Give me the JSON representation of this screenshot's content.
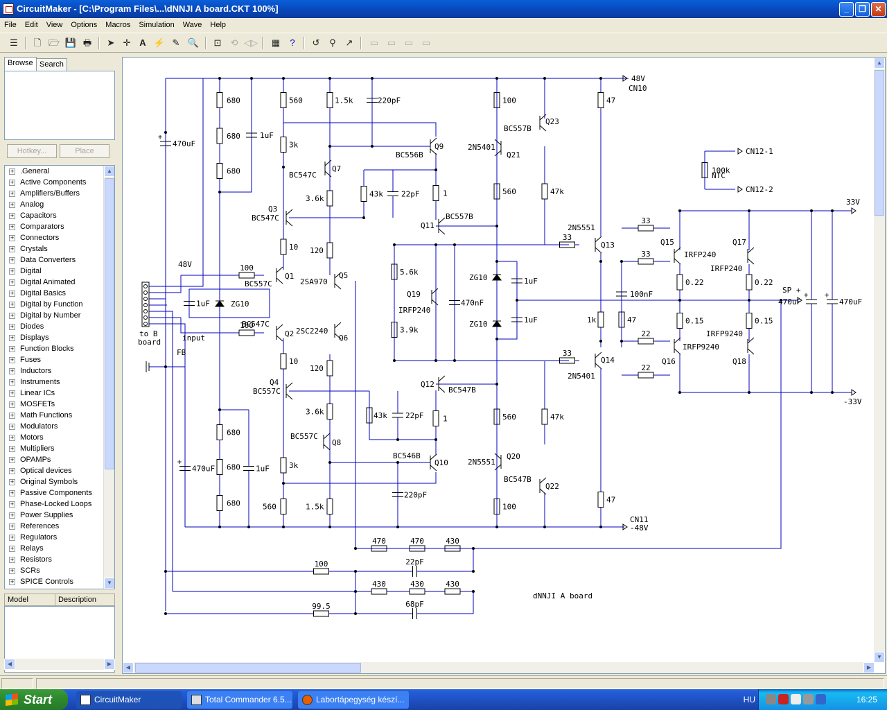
{
  "window": {
    "title": "CircuitMaker - [C:\\Program Files\\...\\dNNJI A board.CKT 100%]"
  },
  "menu": [
    "File",
    "Edit",
    "View",
    "Options",
    "Macros",
    "Simulation",
    "Wave",
    "Help"
  ],
  "panel": {
    "tabs": [
      "Browse",
      "Search"
    ],
    "hotkey": "Hotkey...",
    "place": "Place",
    "library": [
      ".General",
      "Active Components",
      "Amplifiers/Buffers",
      "Analog",
      "Capacitors",
      "Comparators",
      "Connectors",
      "Crystals",
      "Data Converters",
      "Digital",
      "Digital Animated",
      "Digital Basics",
      "Digital by Function",
      "Digital by Number",
      "Diodes",
      "Displays",
      "Function Blocks",
      "Fuses",
      "Inductors",
      "Instruments",
      "Linear ICs",
      "MOSFETs",
      "Math Functions",
      "Modulators",
      "Motors",
      "Multipliers",
      "OPAMPs",
      "Optical devices",
      "Original Symbols",
      "Passive Components",
      "Phase-Locked Loops",
      "Power Supplies",
      "References",
      "Regulators",
      "Relays",
      "Resistors",
      "SCRs",
      "SPICE Controls"
    ],
    "columns": [
      "Model",
      "Description"
    ]
  },
  "schematic": {
    "title": "dNNJI A board",
    "rails": {
      "pos": "48V",
      "pos_conn": "CN10",
      "neg_conn": "CN11",
      "neg": "-48V",
      "out_pos": "33V",
      "out_neg": "-33V",
      "sp": "SP +"
    },
    "ntc": {
      "value": "100k",
      "type": "NTC",
      "c1": "CN12-1",
      "c2": "CN12-2"
    },
    "connector": {
      "label1": "to B",
      "label2": "board"
    },
    "net_labels": {
      "v48": "48V",
      "input": "input",
      "fb": "FB"
    },
    "left_r": [
      "680",
      "680",
      "680",
      "680",
      "680",
      "680"
    ],
    "left_c": [
      "470uF",
      "1uF",
      "470uF",
      "1uF"
    ],
    "input_r": [
      "100",
      "100"
    ],
    "zener": {
      "cap": "1uF",
      "type": "ZG10"
    },
    "col2_r": [
      "560",
      "3k",
      "10",
      "10",
      "3k",
      "560"
    ],
    "col3_r": [
      "1.5k",
      "3.6k",
      "120",
      "120",
      "3.6k",
      "1.5k"
    ],
    "tr": {
      "q1": "Q1",
      "q1t": "BC557C",
      "q2": "Q2",
      "q2t": "BC547C",
      "q3": "Q3",
      "q3t": "BC547C",
      "q4": "Q4",
      "q4t": "BC557C",
      "q5": "Q5",
      "q5t": "2SA970",
      "q6": "Q6",
      "q6t": "2SC2240",
      "q7": "Q7",
      "q7t": "BC547C",
      "q8": "Q8",
      "q8t": "BC557C",
      "q9": "Q9",
      "q9t": "BC556B",
      "q10": "Q10",
      "q10t": "BC546B",
      "q11": "Q11",
      "q11t": "BC557B",
      "q12": "Q12",
      "q12t": "BC547B",
      "q13": "Q13",
      "q13t": "2N5551",
      "q14": "Q14",
      "q14t": "2N5401",
      "q15": "Q15",
      "q15t": "IRFP240",
      "q16": "Q16",
      "q16t": "IRFP9240",
      "q17": "Q17",
      "q17t": "IRFP240",
      "q18": "Q18",
      "q18t": "IRFP9240",
      "q19": "Q19",
      "q19t": "IRFP240",
      "q20": "Q20",
      "q20t": "2N5551",
      "q21": "Q21",
      "q21t": "2N5401",
      "q22": "Q22",
      "q22t": "BC547B",
      "q23": "Q23",
      "q23t": "BC557B"
    },
    "vas": {
      "c_top": "220pF",
      "r43a": "43k",
      "c22a": "22pF",
      "r1a": "1",
      "r1b": "1",
      "r43b": "43k",
      "c22b": "22pF",
      "c_bot": "220pF"
    },
    "bias": {
      "r56": "5.6k",
      "r39": "3.9k",
      "c470n": "470nF",
      "zg1": "ZG10",
      "zg2": "ZG10",
      "c1a": "1uF",
      "c1b": "1uF"
    },
    "cascode": {
      "r100a": "100",
      "r560a": "560",
      "r47ka": "47k",
      "r560b": "560",
      "r47kb": "47k",
      "r100b": "100"
    },
    "driver": {
      "r47a": "47",
      "r33a": "33",
      "r1k": "1k",
      "r47b": "47",
      "r33b": "33",
      "r47c": "47"
    },
    "output": {
      "r33a": "33",
      "r33b": "33",
      "c100n": "100nF",
      "r022a": "0.22",
      "r022b": "0.22",
      "r015a": "0.15",
      "r015b": "0.15",
      "r22a": "22",
      "r22b": "22",
      "c470a": "470uF",
      "c470b": "470uF"
    },
    "fb": {
      "r470a": "470",
      "r470b": "470",
      "r430a": "430",
      "r100": "100",
      "c22p": "22pF",
      "r430b": "430",
      "r430c": "430",
      "r430d": "430",
      "r995": "99.5",
      "c68p": "68pF"
    }
  },
  "taskbar": {
    "start": "Start",
    "tasks": [
      "CircuitMaker",
      "Total Commander 6.5...",
      "Labortápegység készí..."
    ],
    "lang": "HU",
    "clock": "16:25"
  }
}
